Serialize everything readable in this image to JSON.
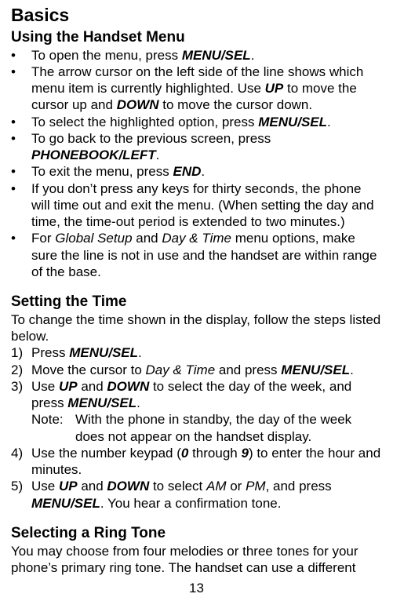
{
  "title": "Basics",
  "section1": {
    "heading": "Using the Handset Menu",
    "items": [
      {
        "marker": "•",
        "parts": [
          {
            "t": "To open the menu, press "
          },
          {
            "t": "MENU/SEL",
            "cls": "b"
          },
          {
            "t": "."
          }
        ]
      },
      {
        "marker": "•",
        "parts": [
          {
            "t": "The arrow cursor on the left side of the line shows which menu item is currently highlighted. Use "
          },
          {
            "t": "UP",
            "cls": "b"
          },
          {
            "t": " to move the cursor up and "
          },
          {
            "t": "DOWN",
            "cls": "b"
          },
          {
            "t": " to move the cursor down."
          }
        ]
      },
      {
        "marker": "•",
        "parts": [
          {
            "t": "To select the highlighted option, press "
          },
          {
            "t": "MENU/SEL",
            "cls": "b"
          },
          {
            "t": "."
          }
        ]
      },
      {
        "marker": "•",
        "parts": [
          {
            "t": "To go back to the previous screen, press "
          },
          {
            "t": "PHONEBOOK/LEFT",
            "cls": "b"
          },
          {
            "t": "."
          }
        ]
      },
      {
        "marker": "•",
        "parts": [
          {
            "t": "To exit the menu, press "
          },
          {
            "t": "END",
            "cls": "b"
          },
          {
            "t": "."
          }
        ]
      },
      {
        "marker": "•",
        "parts": [
          {
            "t": "If you don’t press any keys for thirty seconds, the phone will time out and exit the menu. (When setting the day and time, the time-out period is extended to two minutes.)"
          }
        ]
      },
      {
        "marker": "•",
        "parts": [
          {
            "t": "For "
          },
          {
            "t": "Global Setup",
            "cls": "i"
          },
          {
            "t": " and "
          },
          {
            "t": "Day & Time",
            "cls": "i"
          },
          {
            "t": " menu options, make sure the line is not in use and the handset are within range of the base."
          }
        ]
      }
    ]
  },
  "section2": {
    "heading": "Setting the Time",
    "intro": "To change the time shown in the display, follow the steps listed below.",
    "items": [
      {
        "marker": "1)",
        "parts": [
          {
            "t": "Press "
          },
          {
            "t": "MENU/SEL",
            "cls": "b"
          },
          {
            "t": "."
          }
        ]
      },
      {
        "marker": "2)",
        "parts": [
          {
            "t": "Move the cursor to "
          },
          {
            "t": "Day & Time",
            "cls": "i"
          },
          {
            "t": " and press "
          },
          {
            "t": "MENU/SEL",
            "cls": "b"
          },
          {
            "t": "."
          }
        ]
      },
      {
        "marker": "3)",
        "parts": [
          {
            "t": "Use "
          },
          {
            "t": "UP",
            "cls": "b"
          },
          {
            "t": " and "
          },
          {
            "t": "DOWN",
            "cls": "b"
          },
          {
            "t": " to select the day of the week, and press "
          },
          {
            "t": "MENU/SEL",
            "cls": "b"
          },
          {
            "t": "."
          }
        ],
        "note_label": "Note:",
        "note_body": "With the phone in standby, the day of the week does not appear on the handset display."
      },
      {
        "marker": "4)",
        "parts": [
          {
            "t": "Use the number keypad ("
          },
          {
            "t": "0",
            "cls": "b"
          },
          {
            "t": " through "
          },
          {
            "t": "9",
            "cls": "b"
          },
          {
            "t": ") to enter the hour and minutes."
          }
        ]
      },
      {
        "marker": "5)",
        "parts": [
          {
            "t": "Use "
          },
          {
            "t": "UP",
            "cls": "b"
          },
          {
            "t": " and "
          },
          {
            "t": "DOWN",
            "cls": "b"
          },
          {
            "t": " to select "
          },
          {
            "t": "AM",
            "cls": "i"
          },
          {
            "t": " or "
          },
          {
            "t": "PM",
            "cls": "i"
          },
          {
            "t": ", and press "
          },
          {
            "t": "MENU/SEL",
            "cls": "b"
          },
          {
            "t": ". You hear a confirmation tone."
          }
        ]
      }
    ]
  },
  "section3": {
    "heading": "Selecting a Ring Tone",
    "intro": "You may choose from four melodies or three tones for your phone’s primary ring tone. The handset can use a different"
  },
  "page_number": "13"
}
